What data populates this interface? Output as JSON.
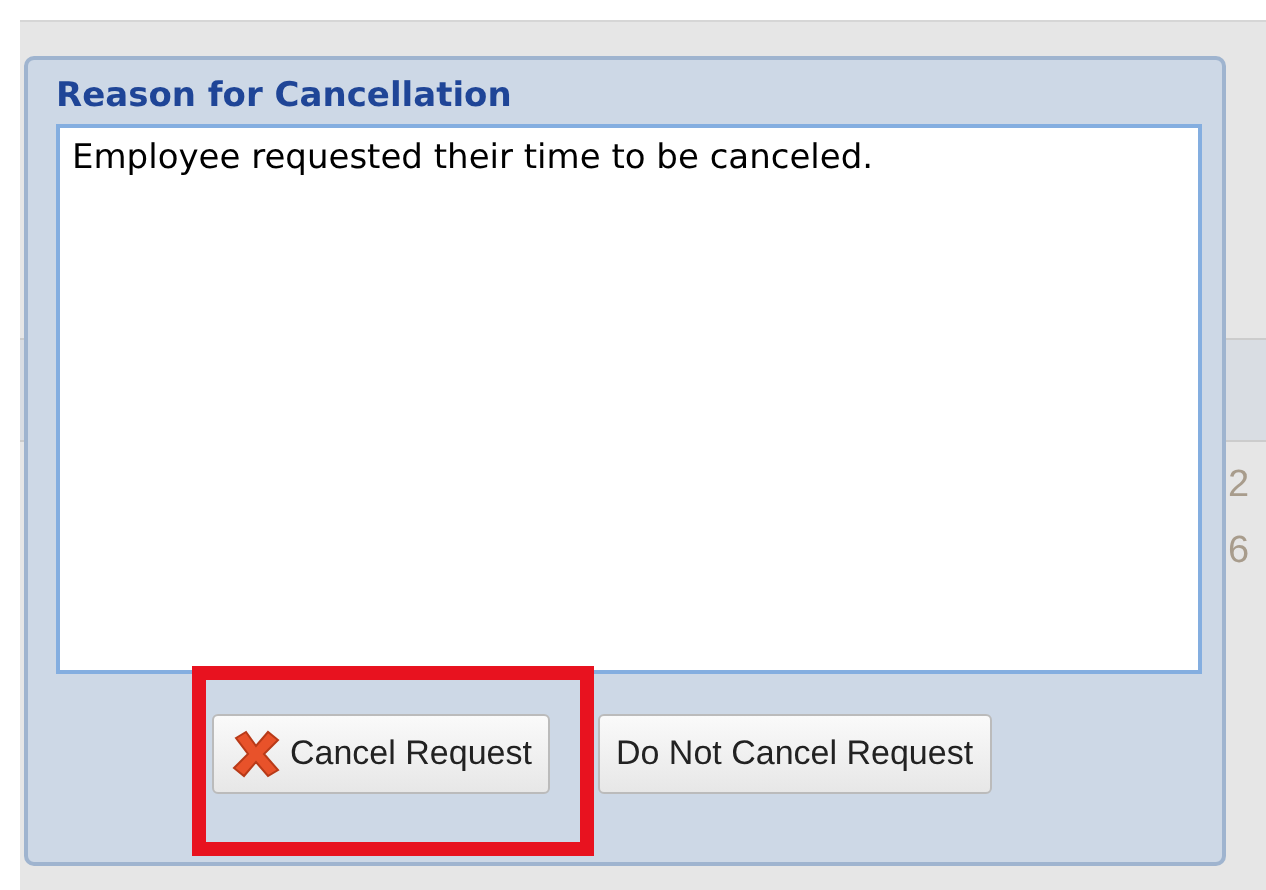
{
  "background": {
    "cells": [
      "2",
      "6"
    ]
  },
  "dialog": {
    "title": "Reason for Cancellation",
    "reason": {
      "value": "Employee requested their time to be canceled."
    },
    "buttons": [
      {
        "label": "Cancel Request",
        "kind": "cancel",
        "highlighted": true
      },
      {
        "label": "Do Not Cancel Request",
        "kind": "plain",
        "highlighted": false
      }
    ]
  }
}
